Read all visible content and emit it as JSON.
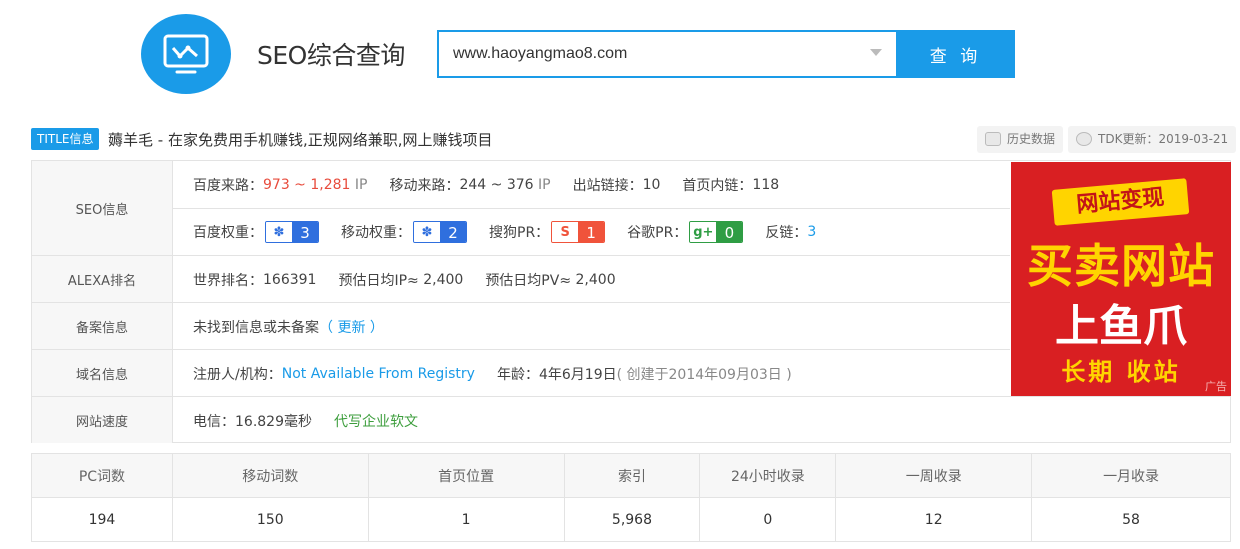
{
  "header": {
    "app_title": "SEO综合查询",
    "search_value": "www.haoyangmao8.com",
    "search_button": "查 询",
    "logo_icon": "chart-monitor-icon"
  },
  "title_bar": {
    "badge": "TITLE信息",
    "site_title": "薅羊毛 - 在家免费用手机赚钱,正规网络兼职,网上赚钱项目",
    "history_label": "历史数据",
    "tdk_label": "TDK更新：2019-03-21"
  },
  "seo": {
    "label": "SEO信息",
    "baidu_traffic_label": "百度来路：",
    "baidu_traffic_value": "973 ~ 1,281",
    "ip_unit": "IP",
    "mobile_traffic_label": "移动来路：",
    "mobile_traffic_value": "244 ~ 376",
    "outbound_label": "出站链接：",
    "outbound_value": "10",
    "internal_label": "首页内链：",
    "internal_value": "118",
    "baidu_weight_label": "百度权重：",
    "baidu_weight_value": "3",
    "mobile_weight_label": "移动权重：",
    "mobile_weight_value": "2",
    "sogou_label": "搜狗PR：",
    "sogou_value": "1",
    "google_label": "谷歌PR：",
    "google_value": "0",
    "backlink_label": "反链：",
    "backlink_value": "3",
    "colors": {
      "baidu": "#2f6fde",
      "sogou": "#f0533b",
      "google": "#2f9d44"
    }
  },
  "alexa": {
    "label": "ALEXA排名",
    "world_rank_label": "世界排名：",
    "world_rank_value": "166391",
    "daily_ip_label": "预估日均IP≈",
    "daily_ip_value": "2,400",
    "daily_pv_label": "预估日均PV≈",
    "daily_pv_value": "2,400"
  },
  "beian": {
    "label": "备案信息",
    "text": "未找到信息或未备案",
    "update_link": "（ 更新 ）"
  },
  "domain": {
    "label": "域名信息",
    "registrant_label": "注册人/机构：",
    "registrant_value": "Not Available From Registry",
    "age_label": "年龄：",
    "age_value": "4年6月19日",
    "created": "( 创建于2014年09月03日 )"
  },
  "speed": {
    "label": "网站速度",
    "telecom": "电信：16.829毫秒",
    "ad_link": "代写企业软文"
  },
  "ad": {
    "banner": "网站变现",
    "big": "买卖网站",
    "mid": "上鱼爪",
    "bottom": "长期  收站",
    "tag": "广告"
  },
  "stats": {
    "headers": [
      "PC词数",
      "移动词数",
      "首页位置",
      "索引",
      "24小时收录",
      "一周收录",
      "一月收录"
    ],
    "values": [
      "194",
      "150",
      "1",
      "5,968",
      "0",
      "12",
      "58"
    ]
  }
}
